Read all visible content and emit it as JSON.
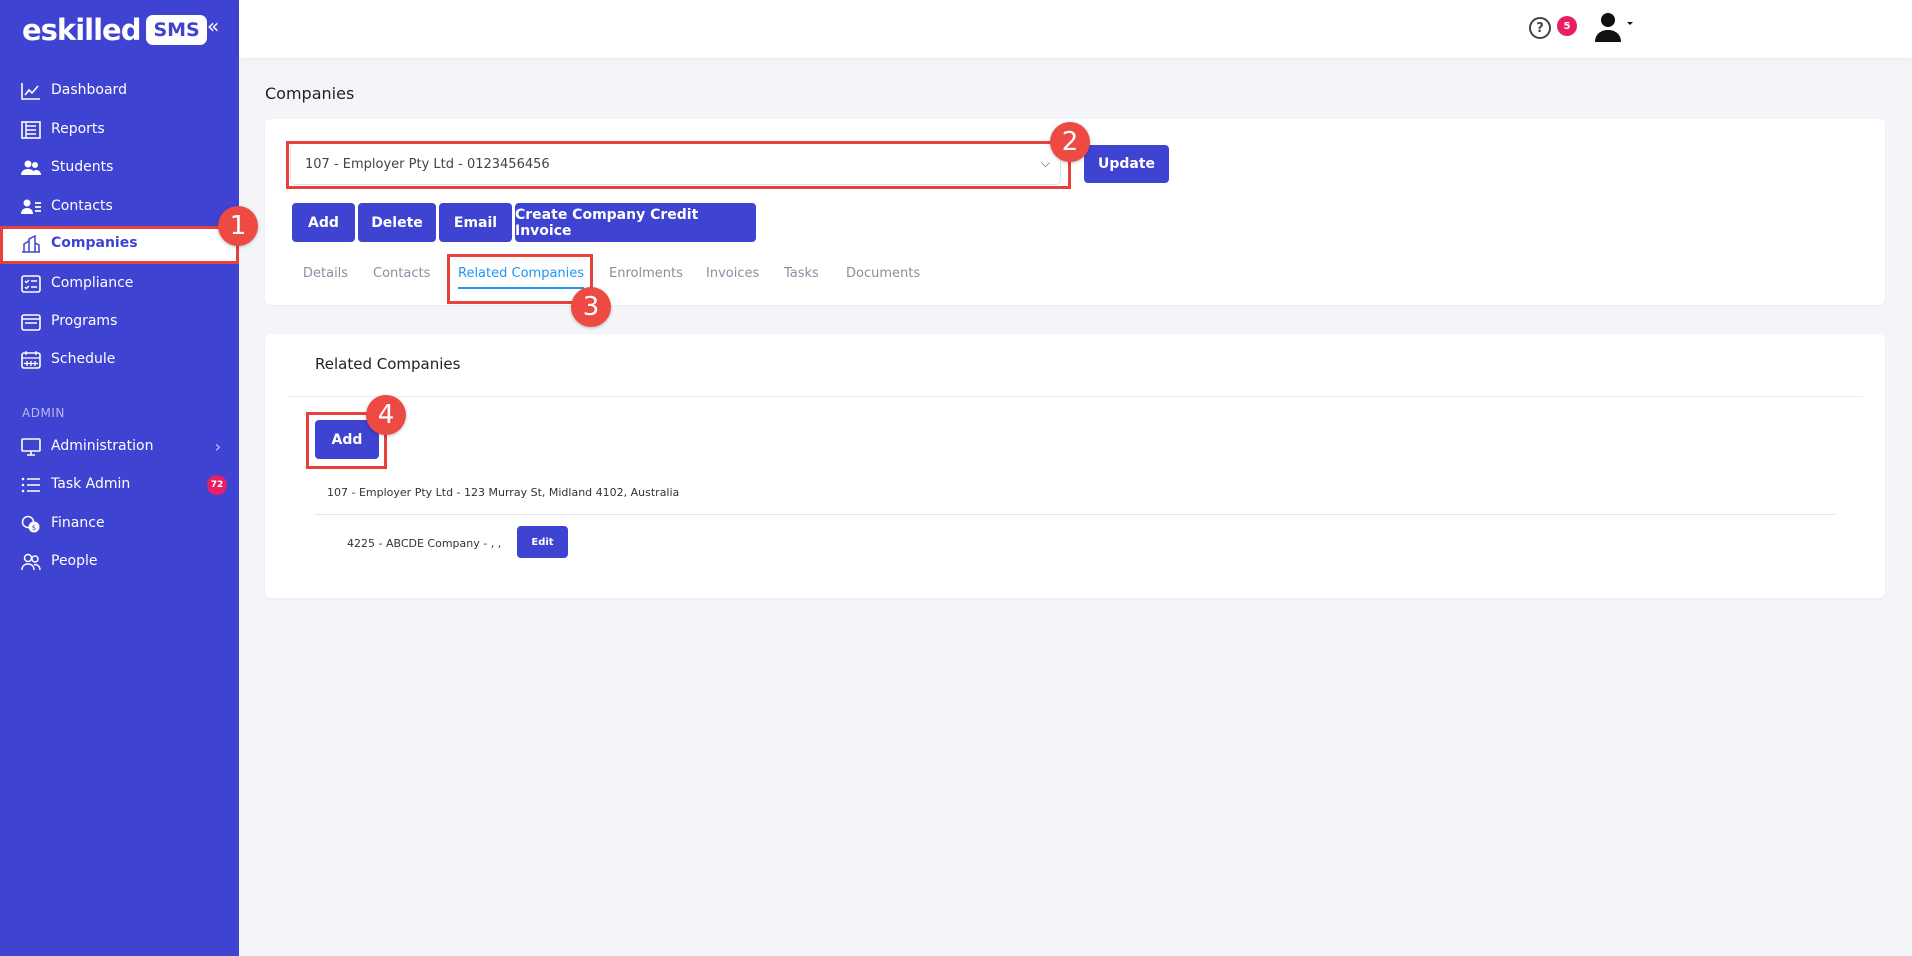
{
  "app": {
    "logo_text": "eskilled",
    "logo_badge": "SMS",
    "collapse_icon": "«"
  },
  "sidebar": {
    "items": [
      {
        "label": "Dashboard",
        "icon": "chart-line-icon"
      },
      {
        "label": "Reports",
        "icon": "report-icon"
      },
      {
        "label": "Students",
        "icon": "students-icon"
      },
      {
        "label": "Contacts",
        "icon": "contacts-icon"
      },
      {
        "label": "Companies",
        "icon": "companies-icon",
        "active": true
      },
      {
        "label": "Compliance",
        "icon": "compliance-icon"
      },
      {
        "label": "Programs",
        "icon": "programs-icon"
      },
      {
        "label": "Schedule",
        "icon": "calendar-icon"
      }
    ],
    "admin_section_label": "ADMIN",
    "admin_items": [
      {
        "label": "Administration",
        "icon": "monitor-icon",
        "chevron": "›"
      },
      {
        "label": "Task Admin",
        "icon": "list-icon",
        "badge": "72"
      },
      {
        "label": "Finance",
        "icon": "coins-icon"
      },
      {
        "label": "People",
        "icon": "people-icon"
      }
    ]
  },
  "topbar": {
    "help_icon": "?",
    "notification_count": "5"
  },
  "page": {
    "title": "Companies"
  },
  "company_selector": {
    "value": "107 - Employer Pty Ltd - 0123456456",
    "chevron": "⌵"
  },
  "actions": {
    "update": "Update",
    "add": "Add",
    "delete": "Delete",
    "email": "Email",
    "create_invoice": "Create Company Credit Invoice"
  },
  "tabs": [
    {
      "label": "Details"
    },
    {
      "label": "Contacts"
    },
    {
      "label": "Related Companies",
      "active": true
    },
    {
      "label": "Enrolments"
    },
    {
      "label": "Invoices"
    },
    {
      "label": "Tasks"
    },
    {
      "label": "Documents"
    }
  ],
  "related": {
    "title": "Related Companies",
    "add_label": "Add",
    "parent": "107 - Employer Pty Ltd - 123 Murray St, Midland 4102, Australia",
    "child": "4225 - ABCDE Company - , ,",
    "edit_label": "Edit"
  },
  "steps": [
    "1",
    "2",
    "3",
    "4"
  ],
  "colors": {
    "sidebar_bg": "#3f43d1",
    "primary_button": "#3f43d1",
    "highlight": "#e8403d",
    "step_marker": "#ee4a44",
    "active_tab": "#2196f3",
    "badge": "#e91e63"
  }
}
